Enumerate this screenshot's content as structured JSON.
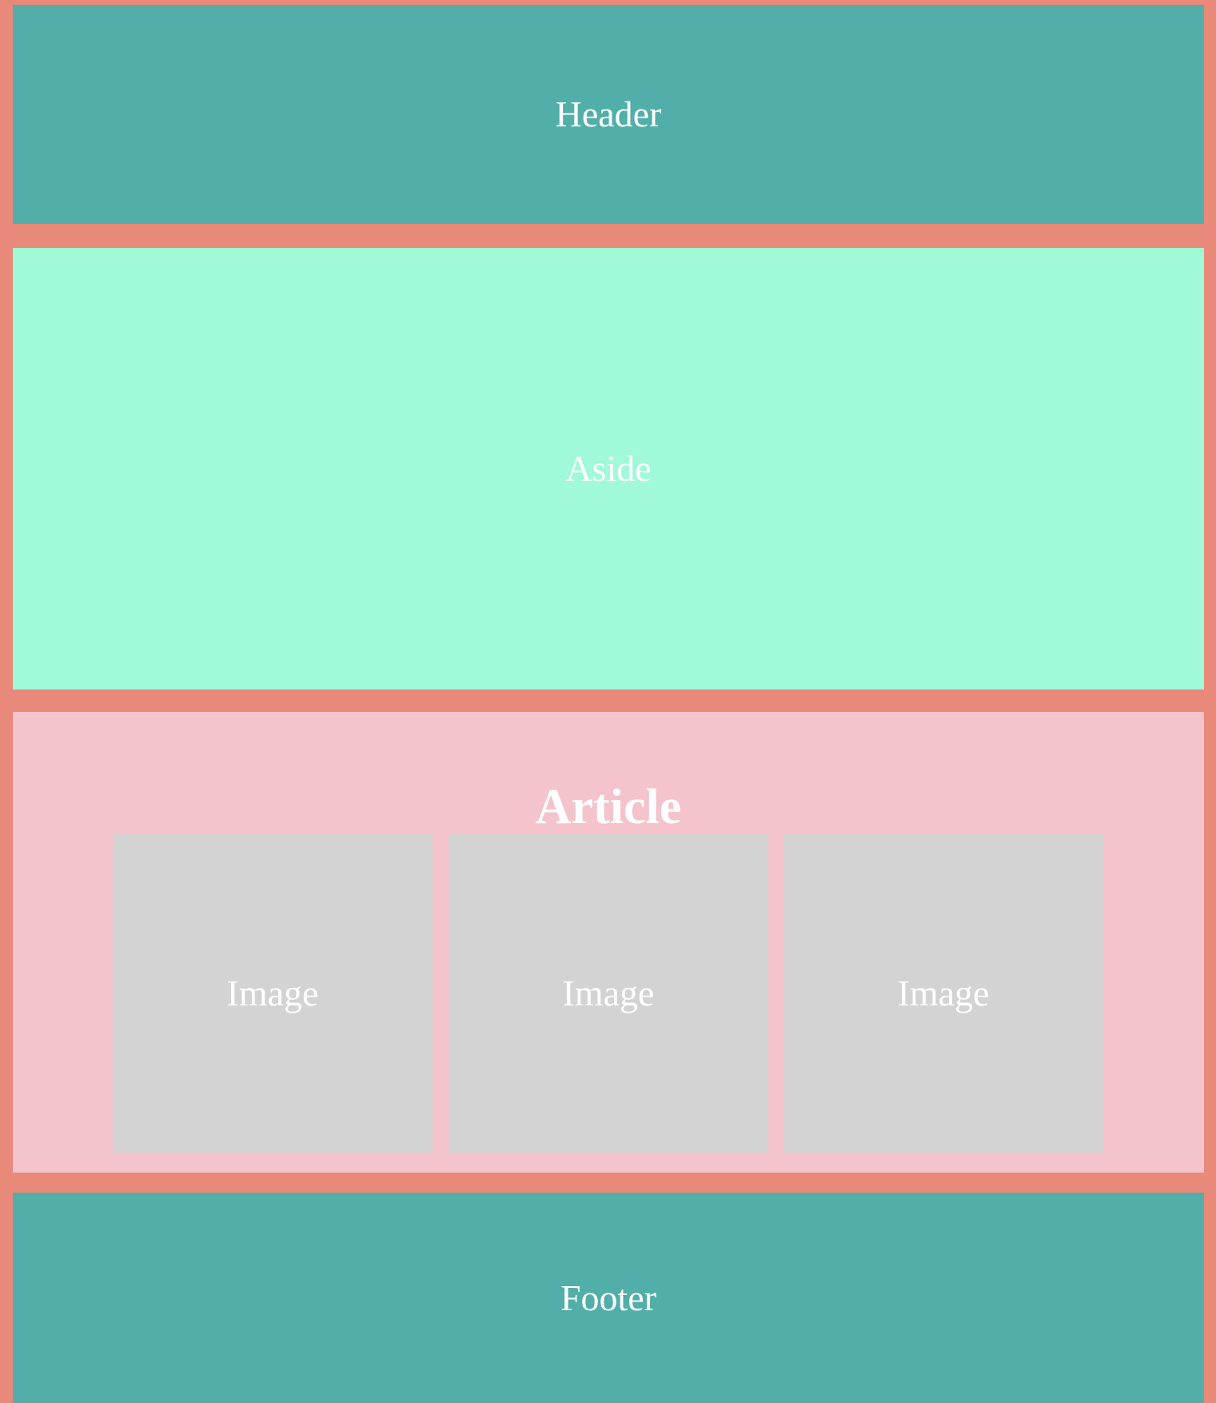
{
  "header": {
    "label": "Header"
  },
  "aside": {
    "label": "Aside"
  },
  "article": {
    "title": "Article",
    "images": [
      {
        "label": "Image"
      },
      {
        "label": "Image"
      },
      {
        "label": "Image"
      }
    ]
  },
  "footer": {
    "label": "Footer"
  },
  "colors": {
    "page_background": "#e8897a",
    "header": "#52aea8",
    "aside": "#a0fad7",
    "article": "#f4c3cc",
    "image_placeholder": "#d3d3d3",
    "footer": "#52aea8",
    "text": "#ffffff"
  }
}
